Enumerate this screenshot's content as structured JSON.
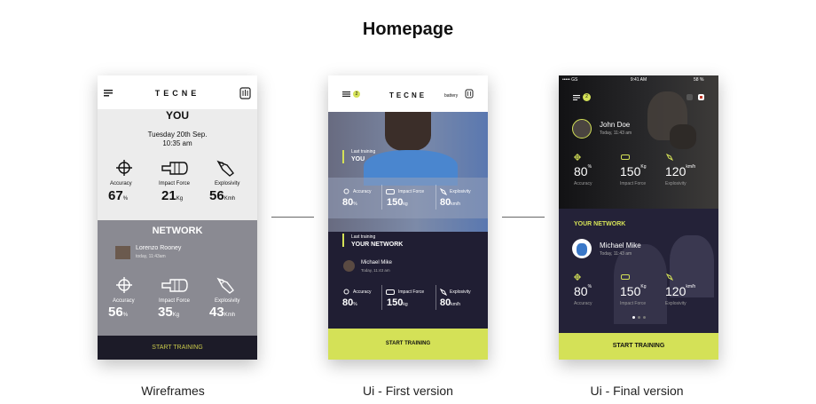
{
  "page": {
    "heading": "Homepage"
  },
  "captions": [
    "Wireframes",
    "Ui - First version",
    "Ui - Final version"
  ],
  "wireframe": {
    "logo": "TECNE",
    "you_title": "YOU",
    "date_line": "Tuesday 20th Sep.",
    "time_line": "10:35 am",
    "stats_you": [
      {
        "label": "Accuracy",
        "value": "67",
        "unit": "%"
      },
      {
        "label": "Impact Force",
        "value": "21",
        "unit": "Kg"
      },
      {
        "label": "Explosivity",
        "value": "56",
        "unit": "Kmh"
      }
    ],
    "network_title": "NETWORK",
    "network_user": "Lorenzo Rooney",
    "network_time": "today, 11:43am",
    "stats_network": [
      {
        "label": "Accuracy",
        "value": "56",
        "unit": "%"
      },
      {
        "label": "Impact Force",
        "value": "35",
        "unit": "Kg"
      },
      {
        "label": "Explosivity",
        "value": "43",
        "unit": "Kmh"
      }
    ],
    "cta": "START TRAINING"
  },
  "first": {
    "logo": "TECNE",
    "badge": "2",
    "battery": "battery",
    "last_training": "Last training",
    "you": "YOU",
    "stats_you": [
      {
        "label": "Accuracy",
        "value": "80",
        "unit": "%"
      },
      {
        "label": "Impact Force",
        "value": "150",
        "unit": "kg"
      },
      {
        "label": "Explosivity",
        "value": "80",
        "unit": "km/h"
      }
    ],
    "last_training_2": "Last training",
    "your_network": "YOUR NETWORK",
    "network_user": "Michael Mike",
    "network_time": "Today, 11:43 am",
    "stats_network": [
      {
        "label": "Accuracy",
        "value": "80",
        "unit": "%"
      },
      {
        "label": "Impact Force",
        "value": "150",
        "unit": "kg"
      },
      {
        "label": "Explosivity",
        "value": "80",
        "unit": "km/h"
      }
    ],
    "cta": "START TRAINING"
  },
  "final": {
    "status_carrier": "••••• GS",
    "status_time": "9:41 AM",
    "status_battery": "58 %",
    "badge": "2",
    "user_name": "John Doe",
    "user_time": "Today, 11:43 am",
    "stats_you": [
      {
        "label": "Accuracy",
        "value": "80",
        "unit": "%"
      },
      {
        "label": "Impact Force",
        "value": "150",
        "unit": "Kg"
      },
      {
        "label": "Explosivity",
        "value": "120",
        "unit": "km/h"
      }
    ],
    "your_network": "YOUR NETWORK",
    "network_user": "Michael Mike",
    "network_time": "Today, 11:43 am",
    "stats_network": [
      {
        "label": "Accuracy",
        "value": "80",
        "unit": "%"
      },
      {
        "label": "Impact Force",
        "value": "150",
        "unit": "Kg"
      },
      {
        "label": "Explosivity",
        "value": "120",
        "unit": "km/h"
      }
    ],
    "cta": "START TRAINING"
  },
  "colors": {
    "accent_lime": "#d4e157",
    "navy": "#201e33",
    "dark_navy": "#1b1a29",
    "wire_grey": "#8a8a92",
    "wire_light": "#ececec"
  }
}
